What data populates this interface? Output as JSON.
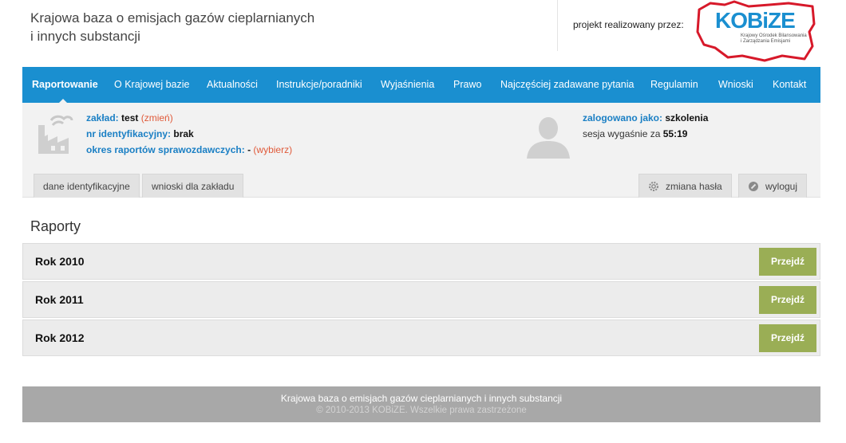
{
  "header": {
    "site_title_line1": "Krajowa baza o emisjach gazów cieplarnianych",
    "site_title_line2": "i innych substancji",
    "partner_label": "projekt realizowany przez:",
    "logo_text": "KOBiZE",
    "logo_sub_line1": "Krajowy Ośrodek Bilansowania",
    "logo_sub_line2": "i Zarządzania Emisjami"
  },
  "nav": {
    "items": [
      {
        "label": "Raportowanie",
        "active": true
      },
      {
        "label": "O Krajowej bazie"
      },
      {
        "label": "Aktualności"
      },
      {
        "label": "Instrukcje/poradniki"
      },
      {
        "label": "Wyjaśnienia"
      },
      {
        "label": "Prawo"
      },
      {
        "label": "Najczęściej zadawane pytania"
      },
      {
        "label": "Regulamin"
      },
      {
        "label": "Wnioski"
      },
      {
        "label": "Kontakt"
      }
    ]
  },
  "info": {
    "zaklad_label": "zakład:",
    "zaklad_value": "test",
    "zaklad_link": "(zmień)",
    "nr_label": "nr identyfikacyjny:",
    "nr_value": "brak",
    "okres_label": "okres raportów sprawozdawczych:",
    "okres_value": "-",
    "okres_link": "(wybierz)",
    "user_label": "zalogowano jako:",
    "user_value": "szkolenia",
    "session_text": "sesja wygaśnie za",
    "session_value": "55:19"
  },
  "tabs": {
    "left": [
      "dane identyfikacyjne",
      "wnioski dla zakładu"
    ],
    "change_password": "zmiana hasła",
    "logout": "wyloguj"
  },
  "reports": {
    "title": "Raporty",
    "button_label": "Przejdź",
    "rows": [
      {
        "name": "Rok 2010"
      },
      {
        "name": "Rok 2011"
      },
      {
        "name": "Rok 2012"
      }
    ]
  },
  "footer": {
    "line1": "Krajowa baza o emisjach gazów cieplarnianych i innych substancji",
    "line2": "© 2010-2013 KOBiZE. Wszelkie prawa zastrzeżone"
  },
  "colors": {
    "accent": "#1a8fd0",
    "button": "#9aae55",
    "link_red": "#e05a3a"
  }
}
